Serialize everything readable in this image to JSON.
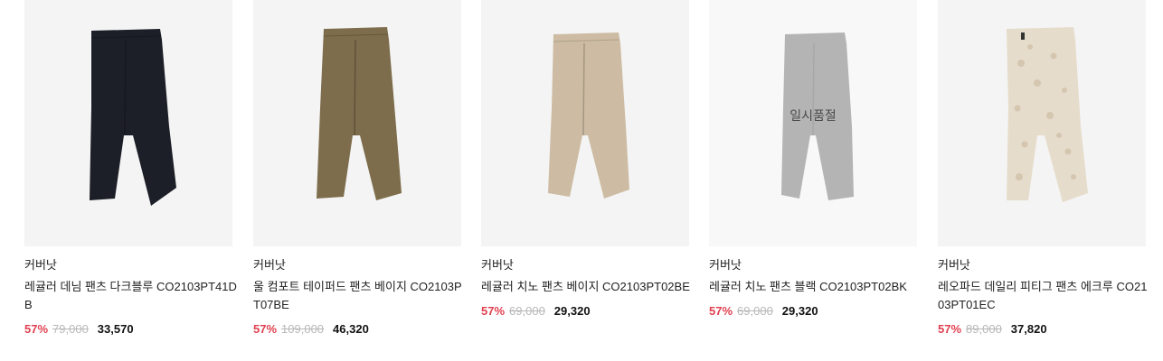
{
  "colors": {
    "discount": "#e0404f",
    "original_price": "#b8b8b8",
    "thumb_bg": "#f4f4f4"
  },
  "products": [
    {
      "image": "pants-dark-denim",
      "brand": "커버낫",
      "name": "레귤러 데님 팬츠 다크블루 CO2103PT41DB",
      "discount": "57%",
      "original_price": "79,000",
      "sale_price": "33,570",
      "pants_color": "#1c1f27",
      "sold_out": false
    },
    {
      "image": "pants-wool-beige",
      "brand": "커버낫",
      "name": "울 컴포트 테이퍼드 팬츠 베이지 CO2103PT07BE",
      "discount": "57%",
      "original_price": "109,000",
      "sale_price": "46,320",
      "pants_color": "#7e6d4c",
      "sold_out": false
    },
    {
      "image": "pants-chino-beige",
      "brand": "커버낫",
      "name": "레귤러 치노 팬츠 베이지 CO2103PT02BE",
      "discount": "57%",
      "original_price": "69,000",
      "sale_price": "29,320",
      "pants_color": "#cdbca3",
      "sold_out": false
    },
    {
      "image": "pants-chino-black",
      "brand": "커버낫",
      "name": "레귤러 치노 팬츠 블랙 CO2103PT02BK",
      "discount": "57%",
      "original_price": "69,000",
      "sale_price": "29,320",
      "pants_color": "#8d8d8d",
      "sold_out": true,
      "sold_out_label": "일시품절"
    },
    {
      "image": "pants-leopard-ecru",
      "brand": "커버낫",
      "name": "레오파드 데일리 피티그 팬츠 에크루 CO2103PT01EC",
      "discount": "57%",
      "original_price": "89,000",
      "sale_price": "37,820",
      "pants_color": "#e6dccb",
      "sold_out": false
    }
  ]
}
